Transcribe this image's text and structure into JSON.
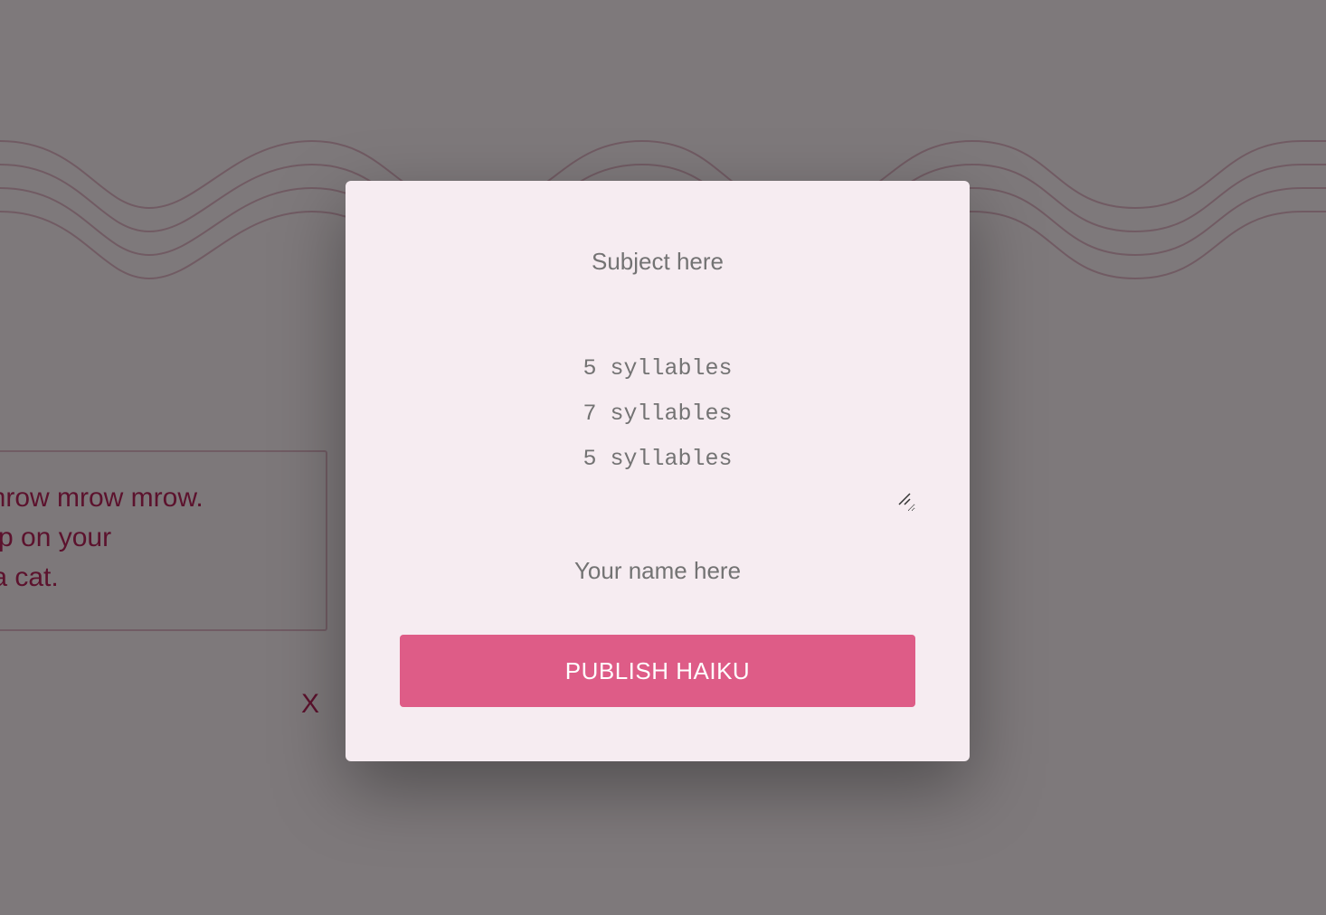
{
  "background_page": {
    "haiku_lines": [
      "v mrow mrow mrow.",
      " step on your",
      "m a cat."
    ],
    "close_label": "X"
  },
  "modal": {
    "subject_placeholder": "Subject here",
    "poem_placeholder": "5 syllables\n7 syllables\n5 syllables",
    "name_placeholder": "Your name here",
    "publish_label": "PUBLISH HAIKU"
  },
  "colors": {
    "accent": "#de5c87",
    "haiku_text": "#b8245a",
    "modal_background": "#f6ecf1",
    "overlay": "rgba(0,0,0,0.5)"
  }
}
